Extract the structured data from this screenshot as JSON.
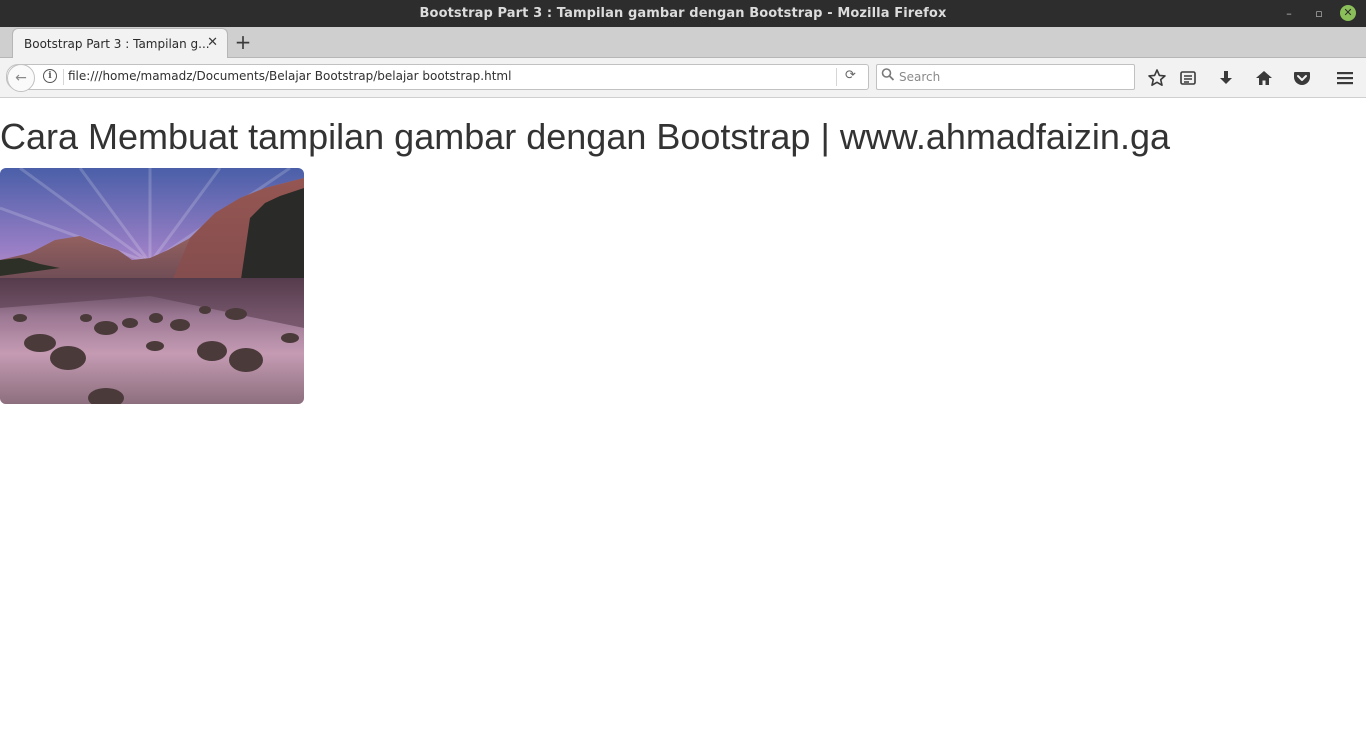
{
  "window": {
    "title": "Bootstrap Part 3 : Tampilan gambar dengan Bootstrap - Mozilla Firefox",
    "controls": {
      "minimize": "–",
      "maximize": "▫",
      "close": "✕"
    }
  },
  "tabs": [
    {
      "label": "Bootstrap Part 3 : Tampilan g...",
      "active": true,
      "close_label": "✕"
    }
  ],
  "new_tab_label": "+",
  "navbar": {
    "back_label": "←",
    "info_label": "i",
    "url": "file:///home/mamadz/Documents/Belajar Bootstrap/belajar bootstrap.html",
    "reload_label": "⟳",
    "search_placeholder": "Search",
    "toolbar_icons": [
      "star-icon",
      "reading-list-icon",
      "download-icon",
      "home-icon",
      "pocket-icon",
      "menu-icon"
    ]
  },
  "page": {
    "heading": "Cara Membuat tampilan gambar dengan Bootstrap | www.ahmadfaizin.ga",
    "image_subject": "mountain lake landscape at sunset with rocks"
  },
  "colors": {
    "titlebar": "#2d2d2d",
    "close_button": "#8bbf59",
    "heading_text": "#333333"
  }
}
